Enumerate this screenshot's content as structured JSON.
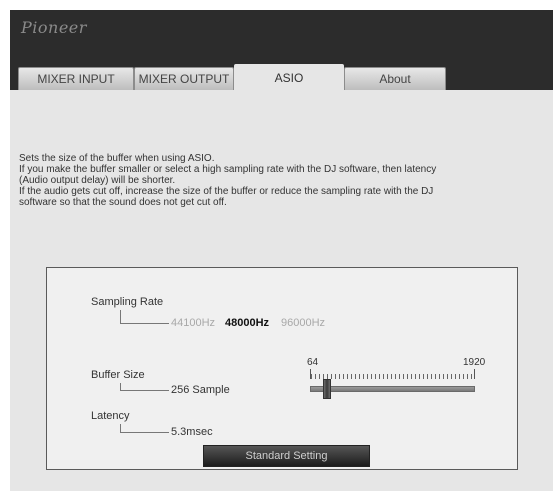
{
  "app": {
    "brand": "Pioneer"
  },
  "tabs": [
    {
      "label": "MIXER INPUT"
    },
    {
      "label": "MIXER OUTPUT"
    },
    {
      "label": "ASIO"
    },
    {
      "label": "About"
    }
  ],
  "active_tab": "ASIO",
  "description": [
    "Sets the size of the buffer when using ASIO.",
    "If you make the buffer smaller or select a high sampling rate with the DJ software, then latency",
    "(Audio output delay) will be shorter.",
    "If the audio gets cut off, increase the size of the buffer or reduce the sampling rate with the DJ",
    "software so that the sound does not get cut off."
  ],
  "sampling_rate": {
    "label": "Sampling Rate",
    "options": [
      "44100Hz",
      "48000Hz",
      "96000Hz"
    ],
    "selected": "48000Hz"
  },
  "buffer_size": {
    "label": "Buffer Size",
    "value": "256 Sample",
    "scale_min": "64",
    "scale_max": "1920",
    "slider_min": 64,
    "slider_max": 1920,
    "slider_value": 256
  },
  "latency": {
    "label": "Latency",
    "value": "5.3msec"
  },
  "standard_button": {
    "label": "Standard Setting"
  },
  "colors": {
    "header_bg": "#2c2c2c",
    "content_bg": "#e6e6e6",
    "button_bg": "#2a2a2a",
    "selected_text": "#111111",
    "unselected_text": "#a8a8a8"
  }
}
